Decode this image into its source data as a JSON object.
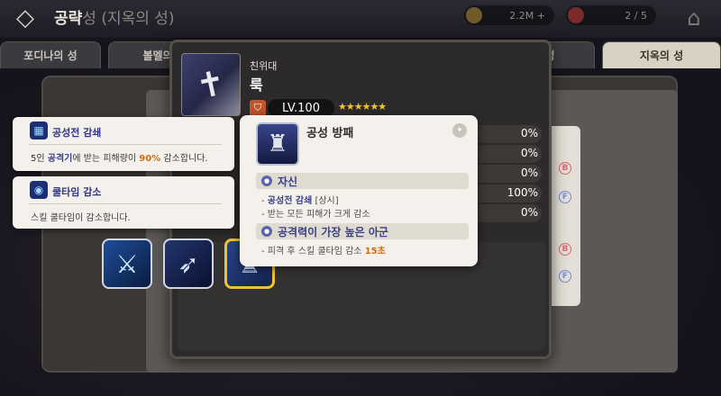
{
  "header": {
    "title_prefix": "공략",
    "title_faded": "성 (지옥의 성)",
    "currency1": "2.2M +",
    "currency2": "2 / 5"
  },
  "tabs": [
    {
      "label": "포디나의 성"
    },
    {
      "label": "볼멜의"
    },
    {
      "label": "성"
    },
    {
      "label": "지옥의 성"
    }
  ],
  "character": {
    "class": "친위대",
    "name": "룩",
    "level": "LV.100",
    "stars": "★★★★★★",
    "stats": [
      "0%",
      "0%",
      "0%",
      "100%",
      "0%"
    ]
  },
  "side_marks": [
    "B",
    "F",
    "B",
    "F"
  ],
  "skill_popup": {
    "title": "공성 방패",
    "section1_title": "자신",
    "section1_line1_prefix": "- ",
    "section1_line1_highlight": "공성전 감쇄",
    "section1_line1_suffix": " [상시]",
    "section1_line2": "- 받는 모든 피해가 크게 감소",
    "section2_title": "공격력이 가장 높은 아군",
    "section2_line1_prefix": "- 피격 후 스킬 쿨타임 감소 ",
    "section2_line1_highlight": "15초"
  },
  "tooltips": [
    {
      "title": "공성전 감쇄",
      "body_prefix": "5인 ",
      "body_highlight1": "공격기",
      "body_mid": "에 받는 피해량이 ",
      "body_highlight2": "90%",
      "body_suffix": " 감소합니다."
    },
    {
      "title": "쿨타임 감소",
      "body": "스킬 쿨타임이 감소합니다."
    }
  ],
  "icons": {
    "back": "back-arrow-icon",
    "home": "home-icon",
    "info": "info-icon"
  }
}
